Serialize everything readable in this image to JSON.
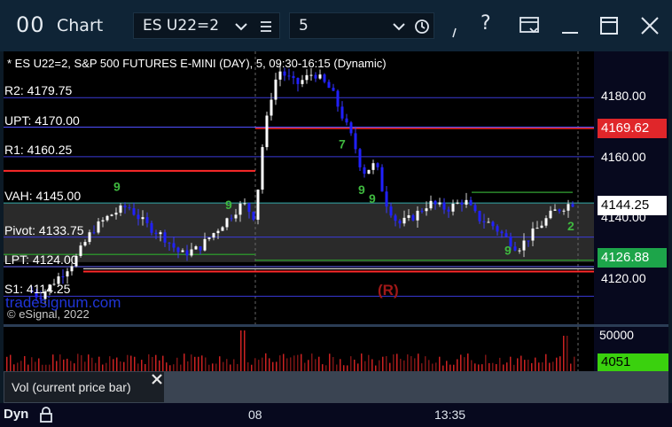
{
  "window": {
    "title": "Chart",
    "app_icon": "00",
    "symbol_value": "ES U22=2",
    "interval_value": "5"
  },
  "chart": {
    "header": "* ES U22=2, S&P 500 FUTURES E-MINI (DAY), 5, 09:30-16:15 (Dynamic)",
    "levels": [
      {
        "label": "R2: 4179.75",
        "price": 4179.75,
        "color": "#3a3ad8"
      },
      {
        "label": "UPT: 4170.00",
        "price": 4170.0,
        "color": "#5050ff"
      },
      {
        "label": "R1: 4160.25",
        "price": 4160.25,
        "color": "#3a3ad8"
      },
      {
        "label": "VAH: 4145.00",
        "price": 4145.0,
        "color": "#33aaaa"
      },
      {
        "label": "Pivot: 4133.75",
        "price": 4133.75,
        "color": "#3a3ad8"
      },
      {
        "label": "LPT: 4124.00",
        "price": 4124.0,
        "color": "#6a6aff"
      },
      {
        "label": "S1: 4114.25",
        "price": 4114.25,
        "color": "#3a3ad8"
      }
    ],
    "watermark": "© eSignal, 2022",
    "site": "tradesignum.com",
    "r_marker": "(R)",
    "price_ticks": [
      "4180.00",
      "4160.00",
      "4140.00",
      "4120.00"
    ],
    "badges": {
      "red": {
        "text": "4169.62",
        "price": 4169.62,
        "color": "#e0262a"
      },
      "white": {
        "text": "4144.25",
        "price": 4144.25
      },
      "green": {
        "text": "4126.88",
        "price": 4126.88,
        "color": "#1da54a"
      }
    },
    "y_range": [
      4105,
      4195
    ],
    "seq_labels": [
      {
        "text": "9",
        "x": 124,
        "price": 4149
      },
      {
        "text": "9",
        "x": 250,
        "price": 4143
      },
      {
        "text": "7",
        "x": 378,
        "price": 4163
      },
      {
        "text": "9",
        "x": 400,
        "price": 4148
      },
      {
        "text": "9",
        "x": 412,
        "price": 4145
      },
      {
        "text": "2",
        "x": 636,
        "price": 4136
      },
      {
        "text": "9",
        "x": 565,
        "price": 4128
      }
    ]
  },
  "volume": {
    "axis_label": "50000",
    "current_value": "4051",
    "max_value": 50000,
    "panel_label": "Vol (current price bar)",
    "close_icon": "close-icon"
  },
  "time_axis": {
    "left_label": "Dyn",
    "lock_icon": "lock-icon",
    "labels": [
      {
        "text": "08"
      },
      {
        "text": "13:35"
      }
    ]
  }
}
